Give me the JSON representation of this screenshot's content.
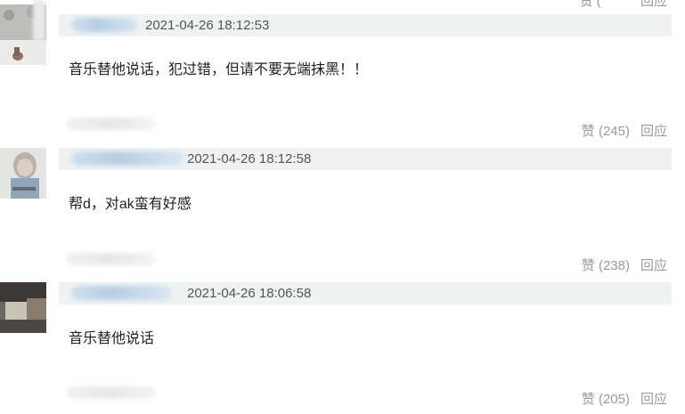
{
  "top_partial": {
    "like": "赞 (",
    "reply": "回应"
  },
  "comments": [
    {
      "timestamp": "2021-04-26 18:12:53",
      "text": "音乐替他说话，犯过错，但请不要无端抹黑！！",
      "likes": "赞 (245)",
      "reply": "回应"
    },
    {
      "timestamp": "2021-04-26 18:12:58",
      "text": "帮d，对ak蛮有好感",
      "likes": "赞 (238)",
      "reply": "回应"
    },
    {
      "timestamp": "2021-04-26 18:06:58",
      "text": "音乐替他说话",
      "likes": "赞 (205)",
      "reply": "回应"
    }
  ],
  "colors": {
    "meta_bar": "#eef3f2",
    "timestamp": "#555555",
    "action_text": "#9a9a9a",
    "username_blur": "#c4d7ea"
  }
}
